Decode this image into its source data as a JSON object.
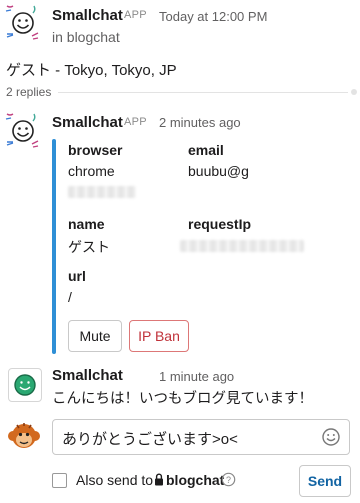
{
  "top_message": {
    "author": "Smallchat",
    "badge": "APP",
    "time": "Today at 12:00 PM",
    "channel_line": "in blogchat",
    "text": "ゲスト - Tokyo, Tokyo, JP",
    "replies": "2 replies"
  },
  "reply1": {
    "author": "Smallchat",
    "badge": "APP",
    "time": "2 minutes ago",
    "fields": {
      "browser_label": "browser",
      "browser_value": "chrome",
      "email_label": "email",
      "email_value": "buubu@g",
      "name_label": "name",
      "name_value": "ゲスト",
      "requestip_label": "requestIp",
      "url_label": "url",
      "url_value": "/"
    },
    "mute_label": "Mute",
    "ipban_label": "IP Ban"
  },
  "reply2": {
    "author": "Smallchat",
    "time": "1 minute ago",
    "text": "こんにちは！いつもブログ見ています！"
  },
  "composer": {
    "value": "ありがとうございます>o<",
    "also_send_label": "Also send to",
    "channel": "blogchat",
    "send_label": "Send"
  },
  "colors": {
    "attachment_bar": "#2e8fd6",
    "danger": "#c0323a",
    "link": "#1264a3"
  }
}
